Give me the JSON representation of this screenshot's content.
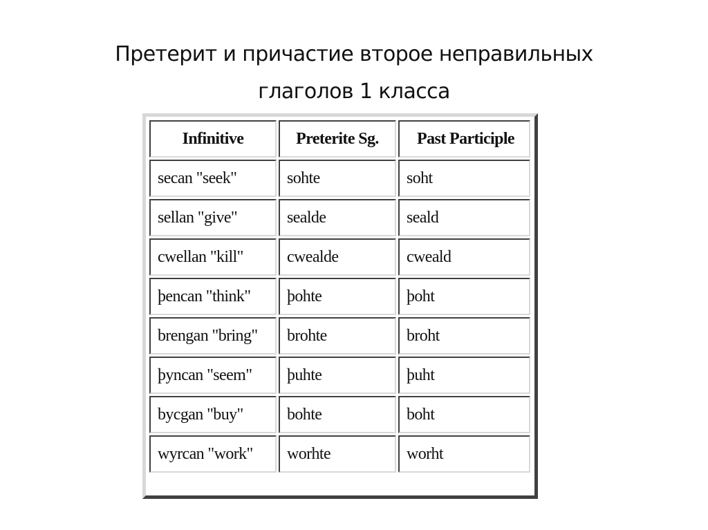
{
  "slide": {
    "title_line1": "Претерит и причастие второе неправильных",
    "title_line2": "глаголов 1 класса"
  },
  "table": {
    "headers": [
      "Infinitive",
      "Preterite Sg.",
      "Past Participle"
    ],
    "rows": [
      [
        "secan \"seek\"",
        "sohte",
        "soht"
      ],
      [
        "sellan \"give\"",
        "sealde",
        "seald"
      ],
      [
        "cwellan \"kill\"",
        "cwealde",
        "cweald"
      ],
      [
        "þencan \"think\"",
        "þohte",
        "þoht"
      ],
      [
        "brengan \"bring\"",
        "brohte",
        "broht"
      ],
      [
        "þyncan \"seem\"",
        "þuhte",
        "þuht"
      ],
      [
        "bycgan \"buy\"",
        "bohte",
        "boht"
      ],
      [
        "wyrcan \"work\"",
        "worhte",
        "worht"
      ]
    ]
  }
}
